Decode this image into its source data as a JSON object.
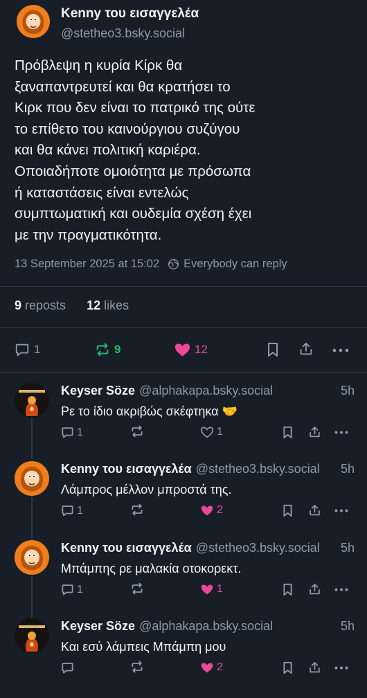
{
  "main_post": {
    "author_name": "Kenny του εισαγγελέα",
    "author_handle": "@stetheo3.bsky.social",
    "text": "Πρόβλεψη η κυρία Κίρκ θα\nξαναπαντρευτεί και θα κρατήσει το\nΚιρκ που δεν είναι το πατρικό της ούτε\nτο επίθετο του καινούργιου συζύγου\nκαι θα κάνει πολιτική καριέρα.\nΟποιαδήποτε ομοιότητα με πρόσωπα\nή καταστάσεις είναι εντελώς\nσυμπτωματική και ουδεμία σχέση έχει\nμε την πραγματικότητα.",
    "timestamp": "13 September 2025 at 15:02",
    "reply_setting": "Everybody can reply",
    "reposts_count": "9",
    "reposts_label": "reposts",
    "likes_count": "12",
    "likes_label": "likes",
    "actions": {
      "replies": "1",
      "reposts": "9",
      "likes": "12"
    }
  },
  "replies": [
    {
      "author_name": "Keyser Söze",
      "author_handle": "@alphakapa.bsky.social",
      "time": "5h",
      "text": "Ρε το ίδιο ακριβώς σκέφτηκα 🤝",
      "reply_count": "1",
      "repost_count": "",
      "like_count": "1",
      "liked": false
    },
    {
      "author_name": "Kenny του εισαγγελέα",
      "author_handle": "@stetheo3.bsky.social",
      "time": "5h",
      "text": "Λάμπρος μέλλον μπροστά της.",
      "reply_count": "1",
      "repost_count": "",
      "like_count": "2",
      "liked": true
    },
    {
      "author_name": "Kenny του εισαγγελέα",
      "author_handle": "@stetheo3.bsky.social",
      "time": "5h",
      "text": "Μπάμπης ρε μαλακία οτοκορεκτ.",
      "reply_count": "1",
      "repost_count": "",
      "like_count": "1",
      "liked": true
    },
    {
      "author_name": "Keyser Söze",
      "author_handle": "@alphakapa.bsky.social",
      "time": "5h",
      "text": "Και εσύ λάμπεις Μπάμπη μου",
      "reply_count": "",
      "repost_count": "",
      "like_count": "2",
      "liked": true
    }
  ],
  "colors": {
    "background": "#171e27",
    "text": "#f1f3f5",
    "muted": "#8d9aab",
    "divider": "#2c3846",
    "repost_active": "#20bc6d",
    "like_active": "#ec4899",
    "kenny_avatar_bg": "#f07e1c"
  },
  "icons": {
    "reply": "speech-bubble-icon",
    "repost": "repost-arrows-icon",
    "like": "heart-icon",
    "bookmark": "bookmark-icon",
    "share": "share-icon",
    "more": "ellipsis-icon",
    "reply_setting": "globe-icon"
  }
}
